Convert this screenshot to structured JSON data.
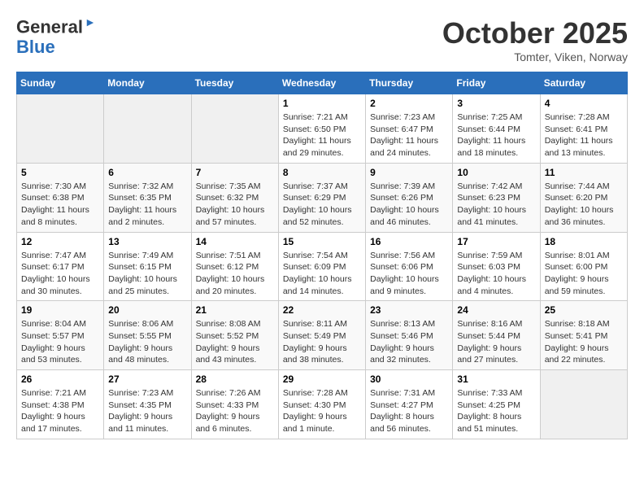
{
  "header": {
    "logo_line1": "General",
    "logo_line2": "Blue",
    "month": "October 2025",
    "location": "Tomter, Viken, Norway"
  },
  "days_of_week": [
    "Sunday",
    "Monday",
    "Tuesday",
    "Wednesday",
    "Thursday",
    "Friday",
    "Saturday"
  ],
  "weeks": [
    [
      {
        "day": "",
        "info": ""
      },
      {
        "day": "",
        "info": ""
      },
      {
        "day": "",
        "info": ""
      },
      {
        "day": "1",
        "info": "Sunrise: 7:21 AM\nSunset: 6:50 PM\nDaylight: 11 hours\nand 29 minutes."
      },
      {
        "day": "2",
        "info": "Sunrise: 7:23 AM\nSunset: 6:47 PM\nDaylight: 11 hours\nand 24 minutes."
      },
      {
        "day": "3",
        "info": "Sunrise: 7:25 AM\nSunset: 6:44 PM\nDaylight: 11 hours\nand 18 minutes."
      },
      {
        "day": "4",
        "info": "Sunrise: 7:28 AM\nSunset: 6:41 PM\nDaylight: 11 hours\nand 13 minutes."
      }
    ],
    [
      {
        "day": "5",
        "info": "Sunrise: 7:30 AM\nSunset: 6:38 PM\nDaylight: 11 hours\nand 8 minutes."
      },
      {
        "day": "6",
        "info": "Sunrise: 7:32 AM\nSunset: 6:35 PM\nDaylight: 11 hours\nand 2 minutes."
      },
      {
        "day": "7",
        "info": "Sunrise: 7:35 AM\nSunset: 6:32 PM\nDaylight: 10 hours\nand 57 minutes."
      },
      {
        "day": "8",
        "info": "Sunrise: 7:37 AM\nSunset: 6:29 PM\nDaylight: 10 hours\nand 52 minutes."
      },
      {
        "day": "9",
        "info": "Sunrise: 7:39 AM\nSunset: 6:26 PM\nDaylight: 10 hours\nand 46 minutes."
      },
      {
        "day": "10",
        "info": "Sunrise: 7:42 AM\nSunset: 6:23 PM\nDaylight: 10 hours\nand 41 minutes."
      },
      {
        "day": "11",
        "info": "Sunrise: 7:44 AM\nSunset: 6:20 PM\nDaylight: 10 hours\nand 36 minutes."
      }
    ],
    [
      {
        "day": "12",
        "info": "Sunrise: 7:47 AM\nSunset: 6:17 PM\nDaylight: 10 hours\nand 30 minutes."
      },
      {
        "day": "13",
        "info": "Sunrise: 7:49 AM\nSunset: 6:15 PM\nDaylight: 10 hours\nand 25 minutes."
      },
      {
        "day": "14",
        "info": "Sunrise: 7:51 AM\nSunset: 6:12 PM\nDaylight: 10 hours\nand 20 minutes."
      },
      {
        "day": "15",
        "info": "Sunrise: 7:54 AM\nSunset: 6:09 PM\nDaylight: 10 hours\nand 14 minutes."
      },
      {
        "day": "16",
        "info": "Sunrise: 7:56 AM\nSunset: 6:06 PM\nDaylight: 10 hours\nand 9 minutes."
      },
      {
        "day": "17",
        "info": "Sunrise: 7:59 AM\nSunset: 6:03 PM\nDaylight: 10 hours\nand 4 minutes."
      },
      {
        "day": "18",
        "info": "Sunrise: 8:01 AM\nSunset: 6:00 PM\nDaylight: 9 hours\nand 59 minutes."
      }
    ],
    [
      {
        "day": "19",
        "info": "Sunrise: 8:04 AM\nSunset: 5:57 PM\nDaylight: 9 hours\nand 53 minutes."
      },
      {
        "day": "20",
        "info": "Sunrise: 8:06 AM\nSunset: 5:55 PM\nDaylight: 9 hours\nand 48 minutes."
      },
      {
        "day": "21",
        "info": "Sunrise: 8:08 AM\nSunset: 5:52 PM\nDaylight: 9 hours\nand 43 minutes."
      },
      {
        "day": "22",
        "info": "Sunrise: 8:11 AM\nSunset: 5:49 PM\nDaylight: 9 hours\nand 38 minutes."
      },
      {
        "day": "23",
        "info": "Sunrise: 8:13 AM\nSunset: 5:46 PM\nDaylight: 9 hours\nand 32 minutes."
      },
      {
        "day": "24",
        "info": "Sunrise: 8:16 AM\nSunset: 5:44 PM\nDaylight: 9 hours\nand 27 minutes."
      },
      {
        "day": "25",
        "info": "Sunrise: 8:18 AM\nSunset: 5:41 PM\nDaylight: 9 hours\nand 22 minutes."
      }
    ],
    [
      {
        "day": "26",
        "info": "Sunrise: 7:21 AM\nSunset: 4:38 PM\nDaylight: 9 hours\nand 17 minutes."
      },
      {
        "day": "27",
        "info": "Sunrise: 7:23 AM\nSunset: 4:35 PM\nDaylight: 9 hours\nand 11 minutes."
      },
      {
        "day": "28",
        "info": "Sunrise: 7:26 AM\nSunset: 4:33 PM\nDaylight: 9 hours\nand 6 minutes."
      },
      {
        "day": "29",
        "info": "Sunrise: 7:28 AM\nSunset: 4:30 PM\nDaylight: 9 hours\nand 1 minute."
      },
      {
        "day": "30",
        "info": "Sunrise: 7:31 AM\nSunset: 4:27 PM\nDaylight: 8 hours\nand 56 minutes."
      },
      {
        "day": "31",
        "info": "Sunrise: 7:33 AM\nSunset: 4:25 PM\nDaylight: 8 hours\nand 51 minutes."
      },
      {
        "day": "",
        "info": ""
      }
    ]
  ]
}
